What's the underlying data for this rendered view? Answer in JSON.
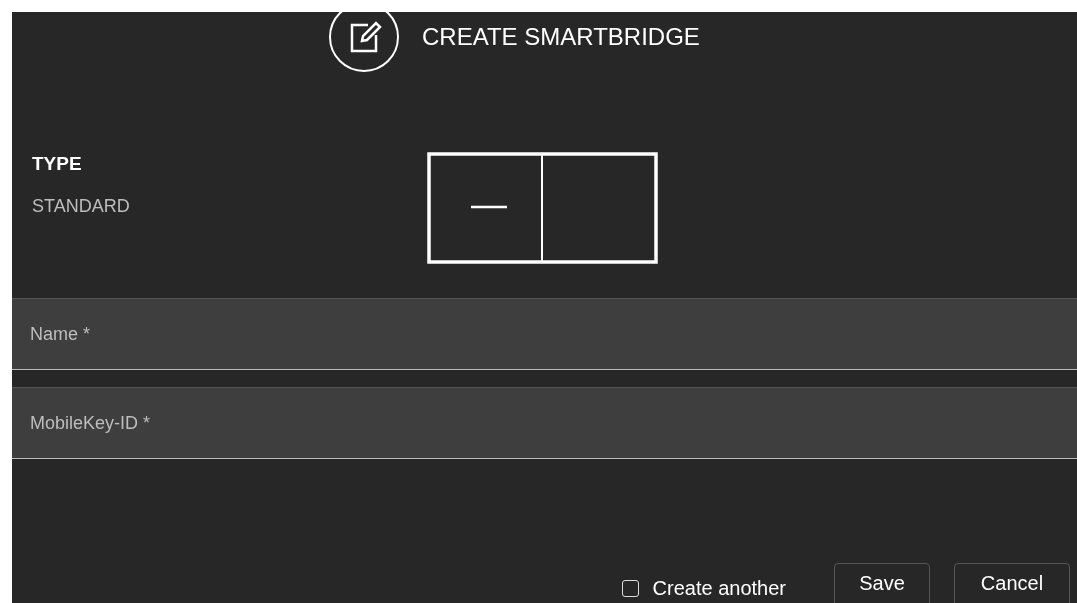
{
  "dialog": {
    "title": "CREATE SMARTBRIDGE"
  },
  "type": {
    "label": "TYPE",
    "value": "STANDARD"
  },
  "fields": [
    {
      "placeholder": "Name *"
    },
    {
      "placeholder": "MobileKey-ID *"
    }
  ],
  "create_another": {
    "label": "Create another",
    "checked": false
  },
  "buttons": [
    "Save",
    "Cancel"
  ]
}
